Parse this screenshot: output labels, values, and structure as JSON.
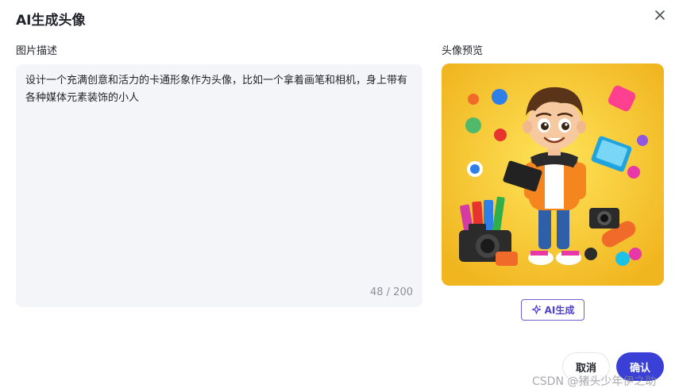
{
  "dialog": {
    "title": "AI生成头像",
    "close_icon": "close-icon"
  },
  "description": {
    "label": "图片描述",
    "value": "设计一个充满创意和活力的卡通形象作为头像，比如一个拿着画笔和相机，身上带有各种媒体元素装饰的小人",
    "counter": "48 / 200"
  },
  "preview": {
    "label": "头像预览",
    "background_color": "#f4bf2a"
  },
  "actions": {
    "ai_generate_label": "AI生成",
    "ai_icon": "sparkle-icon",
    "cancel_label": "取消",
    "confirm_label": "确认",
    "accent_color": "#3a3fd6"
  },
  "watermark": {
    "text": "CSDN @猪头少年伊之助"
  }
}
